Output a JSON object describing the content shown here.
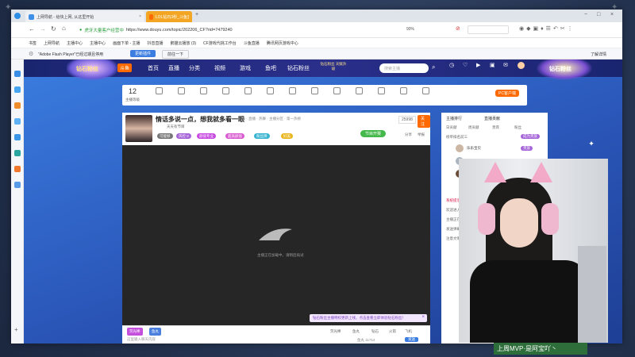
{
  "browser": {
    "tabs": [
      {
        "label": "上网导航 - 给快上网, 从这里开始"
      },
      {
        "label": "LOL钻石3秒_斗鱼直播平台"
      }
    ],
    "url": "https://www.douyu.com/topic/202206_CF?rid=7479240",
    "url_prefix": "虎牙大量客户经营中",
    "zoom": "90%",
    "bookmarks": [
      "书签",
      "上网导航",
      "主播中心",
      "主播中心",
      "画面下单 - 主播",
      "抖音直播",
      "鹅猫云播放 (3)",
      "CF游戏代挑工作台",
      "斗鱼直播",
      "腾讯网页游戏中心"
    ],
    "flash_notice": "\"Adobe Flash Player\"已经过期且停用",
    "flash_update": "更新插件",
    "flash_remind": "前往一下",
    "flash_close": "了解详情"
  },
  "site": {
    "logo": "斗鱼",
    "event_badge": "钻石粉丝",
    "nav": [
      "首页",
      "直播",
      "分类",
      "视频",
      "游戏",
      "鱼吧",
      "钻石粉丝"
    ],
    "nav_hint": "钻石粉丝 天赋升级",
    "search_placeholder": "搜索主播",
    "user_menu": [
      "历史",
      "关注",
      "开播",
      "客户端",
      "消息",
      "个人中心"
    ],
    "banner_right": "钻石粉丝"
  },
  "toolbar2": {
    "level": "12",
    "level_label": "主播等级",
    "items": [
      "直播节目",
      "主播节",
      "音乐",
      "房间一起玩",
      "主播任务",
      "钻石相关",
      "弹幕任务",
      "分享",
      "心愿单",
      "开播提醒",
      "礼物",
      "主题",
      "客服中心"
    ],
    "right_label": "PC客户端"
  },
  "room": {
    "title": "情话多说一点，想我就多看一眼",
    "meta1": "斗鱼 · 直播 · 热舞 · 主播分区 · 第一热榜",
    "meta2": "天天有节目",
    "follow_count": "25998",
    "follow_button": "关注",
    "share": "分享",
    "report": "举报",
    "heat_badge": "节目开赛",
    "tags": [
      "可能够",
      "风控 8",
      "颜值专业",
      "超高颜值",
      "粉丝牌",
      "好美"
    ],
    "status_text": "主播正在加载中，请稍后再试",
    "notice": "钻石粉丝主播特权更新上线，点击查看立即体验钻石粉丝！",
    "notice_close": "关闭"
  },
  "gifts": {
    "left": [
      "荧光棒",
      "鱼丸"
    ],
    "items": [
      "荧光棒",
      "鱼丸",
      "钻石",
      "火箭",
      "飞机",
      "超火"
    ],
    "input_placeholder": "这里输入聊天内容",
    "send": "发送",
    "count": "1",
    "fans_label": "鱼丸 11714"
  },
  "chat": {
    "tabs": [
      "主播排行",
      "直播贡献"
    ],
    "subtabs": [
      "日贡献",
      "周贡献",
      "贵宾",
      "粉丝"
    ],
    "rank_title": "榜单排名前三",
    "rank_button": "成为贵族",
    "users": [
      "乐乐宝贝",
      "Fish王大",
      "三三"
    ],
    "badges": [
      "贵族",
      "贵族",
      "贵族"
    ],
    "messages": [
      "系统提示",
      "欢迎进入直播间",
      "主播正在连线中",
      "发送弹幕",
      "注意文明用语"
    ]
  },
  "webcam": {
    "caption": "上周MVP·是阿宝吖丶"
  }
}
